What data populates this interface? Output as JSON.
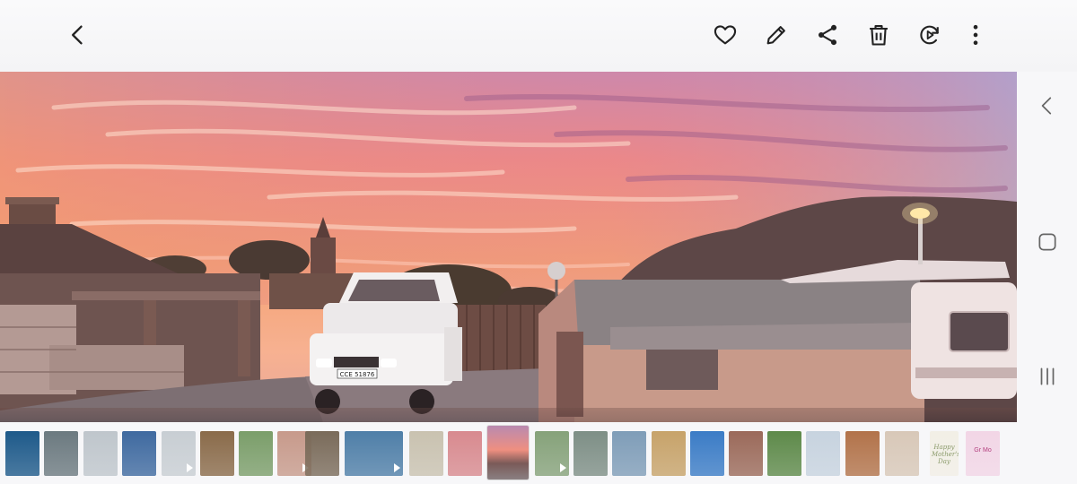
{
  "toolbar": {
    "back_icon": "chevron-left-icon",
    "actions": [
      "heart-icon",
      "pencil-icon",
      "share-icon",
      "trash-icon",
      "rotate-play-icon",
      "more-vertical-icon"
    ]
  },
  "photo": {
    "scene": "sunset-campsite",
    "number_plate": "CCE 51876"
  },
  "navbar": {
    "icons": [
      "back-nav-icon",
      "home-nav-icon",
      "recents-nav-icon"
    ]
  },
  "filmstrip": {
    "selected_index": 12,
    "thumb_colors": [
      "#1e5a8a",
      "#6c7a80",
      "#bfc6cc",
      "#3f6aa0",
      "#c8ced3",
      "#8a6b4a",
      "#7b9e6a",
      "#c79a8b",
      "#7a6b5a",
      "#4f7fa8",
      "#c9c2b0",
      "#d88a8f",
      "#6f8e7a",
      "#86a27a",
      "#7e8f86",
      "#7f9db8",
      "#c7a36a",
      "#3b7cc6",
      "#9b6a5a",
      "#5e8a4a",
      "#c7d3df",
      "#b2734a",
      "#d8c8b8",
      "#f2efe6",
      "#f2d6e6"
    ],
    "card_text": "Happy Mother's Day",
    "card_text_2": "Gr Mo"
  }
}
